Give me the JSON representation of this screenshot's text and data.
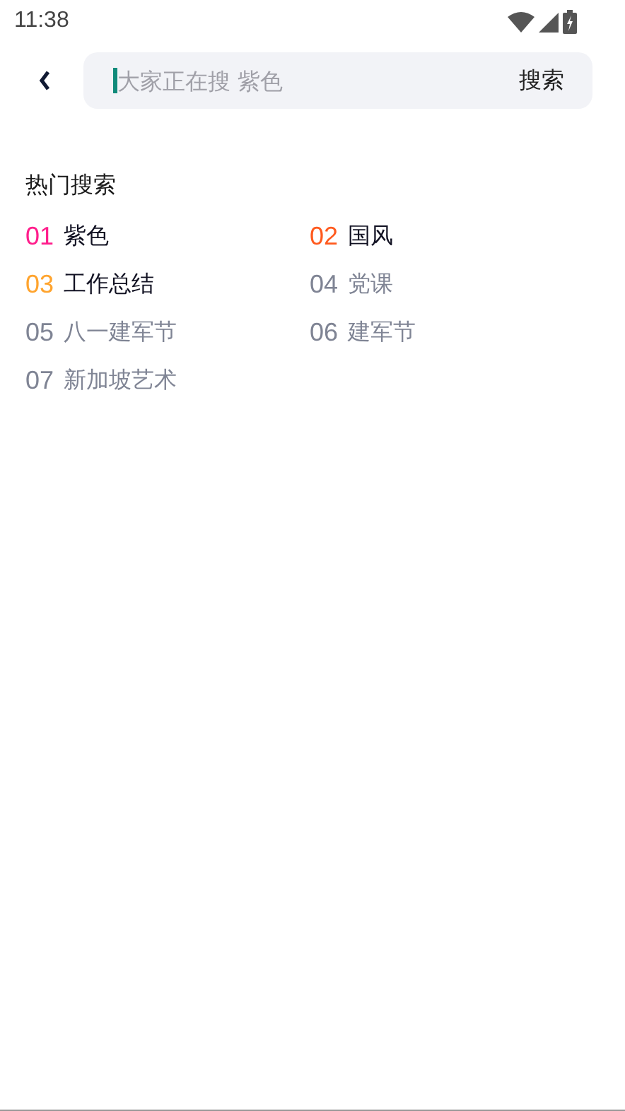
{
  "status_bar": {
    "time": "11:38"
  },
  "search": {
    "placeholder": "大家正在搜 紫色",
    "button": "搜索"
  },
  "hot_search": {
    "title": "热门搜索",
    "items": [
      {
        "rank": "01",
        "term": "紫色",
        "color": "#ff1e8c",
        "kind": "top"
      },
      {
        "rank": "02",
        "term": "国风",
        "color": "#ff5a1e",
        "kind": "top"
      },
      {
        "rank": "03",
        "term": "工作总结",
        "color": "#ffa42e",
        "kind": "top"
      },
      {
        "rank": "04",
        "term": "党课",
        "color": "#7f8494",
        "kind": "normal"
      },
      {
        "rank": "05",
        "term": "八一建军节",
        "color": "#7f8494",
        "kind": "normal"
      },
      {
        "rank": "06",
        "term": "建军节",
        "color": "#7f8494",
        "kind": "normal"
      },
      {
        "rank": "07",
        "term": "新加坡艺术",
        "color": "#7f8494",
        "kind": "normal"
      }
    ]
  }
}
